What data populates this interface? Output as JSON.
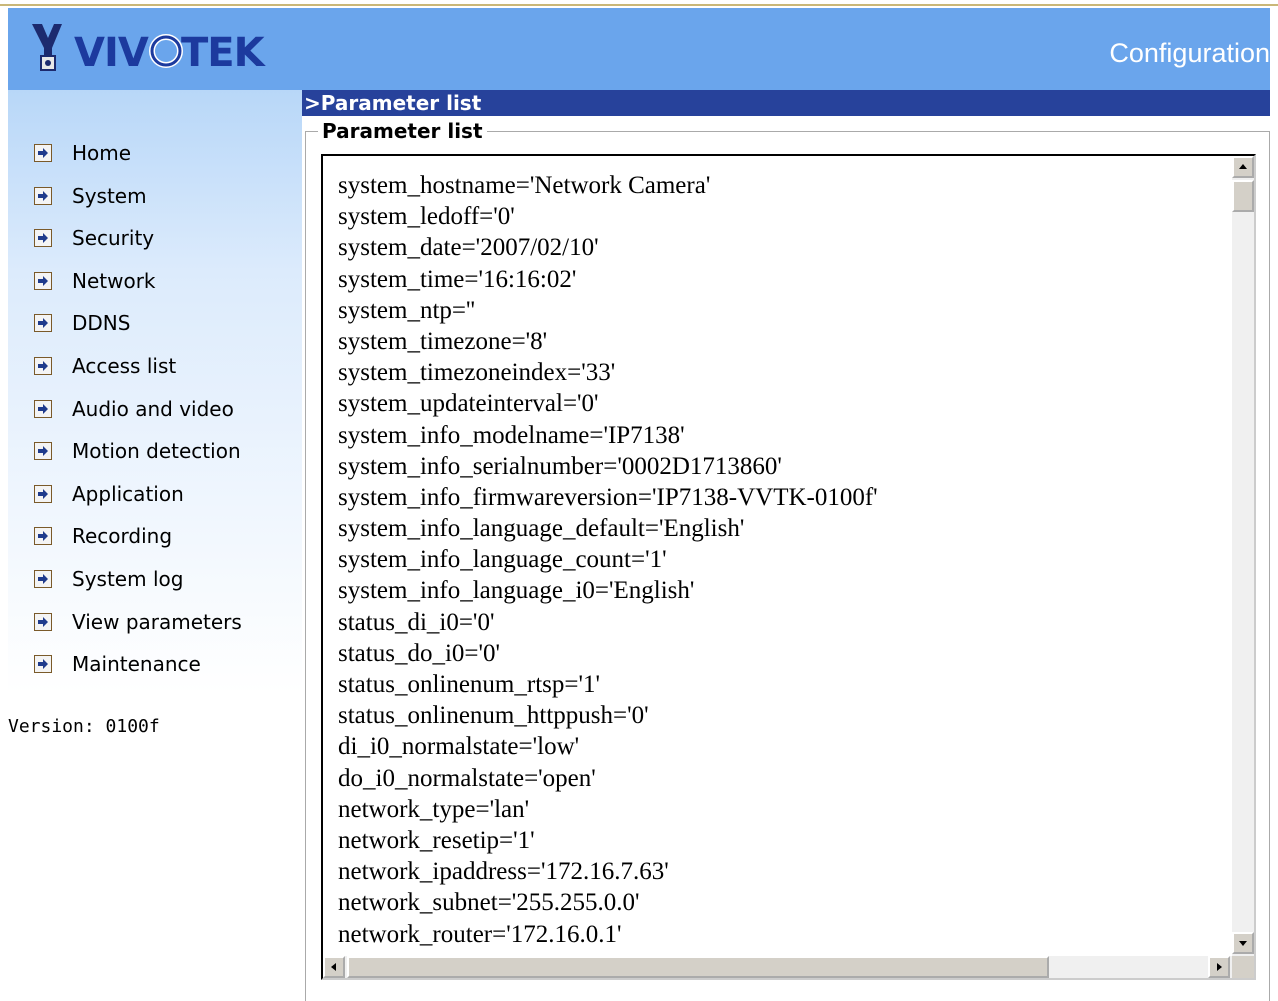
{
  "header": {
    "brand": "VIVOTEK",
    "title": "Configuration"
  },
  "sidebar": {
    "items": [
      {
        "label": "Home"
      },
      {
        "label": "System"
      },
      {
        "label": "Security"
      },
      {
        "label": "Network"
      },
      {
        "label": "DDNS"
      },
      {
        "label": "Access list"
      },
      {
        "label": "Audio and video"
      },
      {
        "label": "Motion detection"
      },
      {
        "label": "Application"
      },
      {
        "label": "Recording"
      },
      {
        "label": "System log"
      },
      {
        "label": "View parameters"
      },
      {
        "label": "Maintenance"
      }
    ],
    "version": "Version: 0100f",
    "bullet_icon": "arrow-right-bullet-icon"
  },
  "main": {
    "section_title": ">Parameter list",
    "fieldset_legend": "Parameter list",
    "parameters": [
      "system_hostname='Network Camera'",
      "system_ledoff='0'",
      "system_date='2007/02/10'",
      "system_time='16:16:02'",
      "system_ntp=''",
      "system_timezone='8'",
      "system_timezoneindex='33'",
      "system_updateinterval='0'",
      "system_info_modelname='IP7138'",
      "system_info_serialnumber='0002D1713860'",
      "system_info_firmwareversion='IP7138-VVTK-0100f'",
      "system_info_language_default='English'",
      "system_info_language_count='1'",
      "system_info_language_i0='English'",
      "status_di_i0='0'",
      "status_do_i0='0'",
      "status_onlinenum_rtsp='1'",
      "status_onlinenum_httppush='0'",
      "di_i0_normalstate='low'",
      "do_i0_normalstate='open'",
      "network_type='lan'",
      "network_resetip='1'",
      "network_ipaddress='172.16.7.63'",
      "network_subnet='255.255.0.0'",
      "network_router='172.16.0.1'"
    ]
  },
  "colors": {
    "header_bg": "#6aa5ec",
    "section_bar_bg": "#27429b",
    "logo_blue": "#1c3a9e"
  }
}
